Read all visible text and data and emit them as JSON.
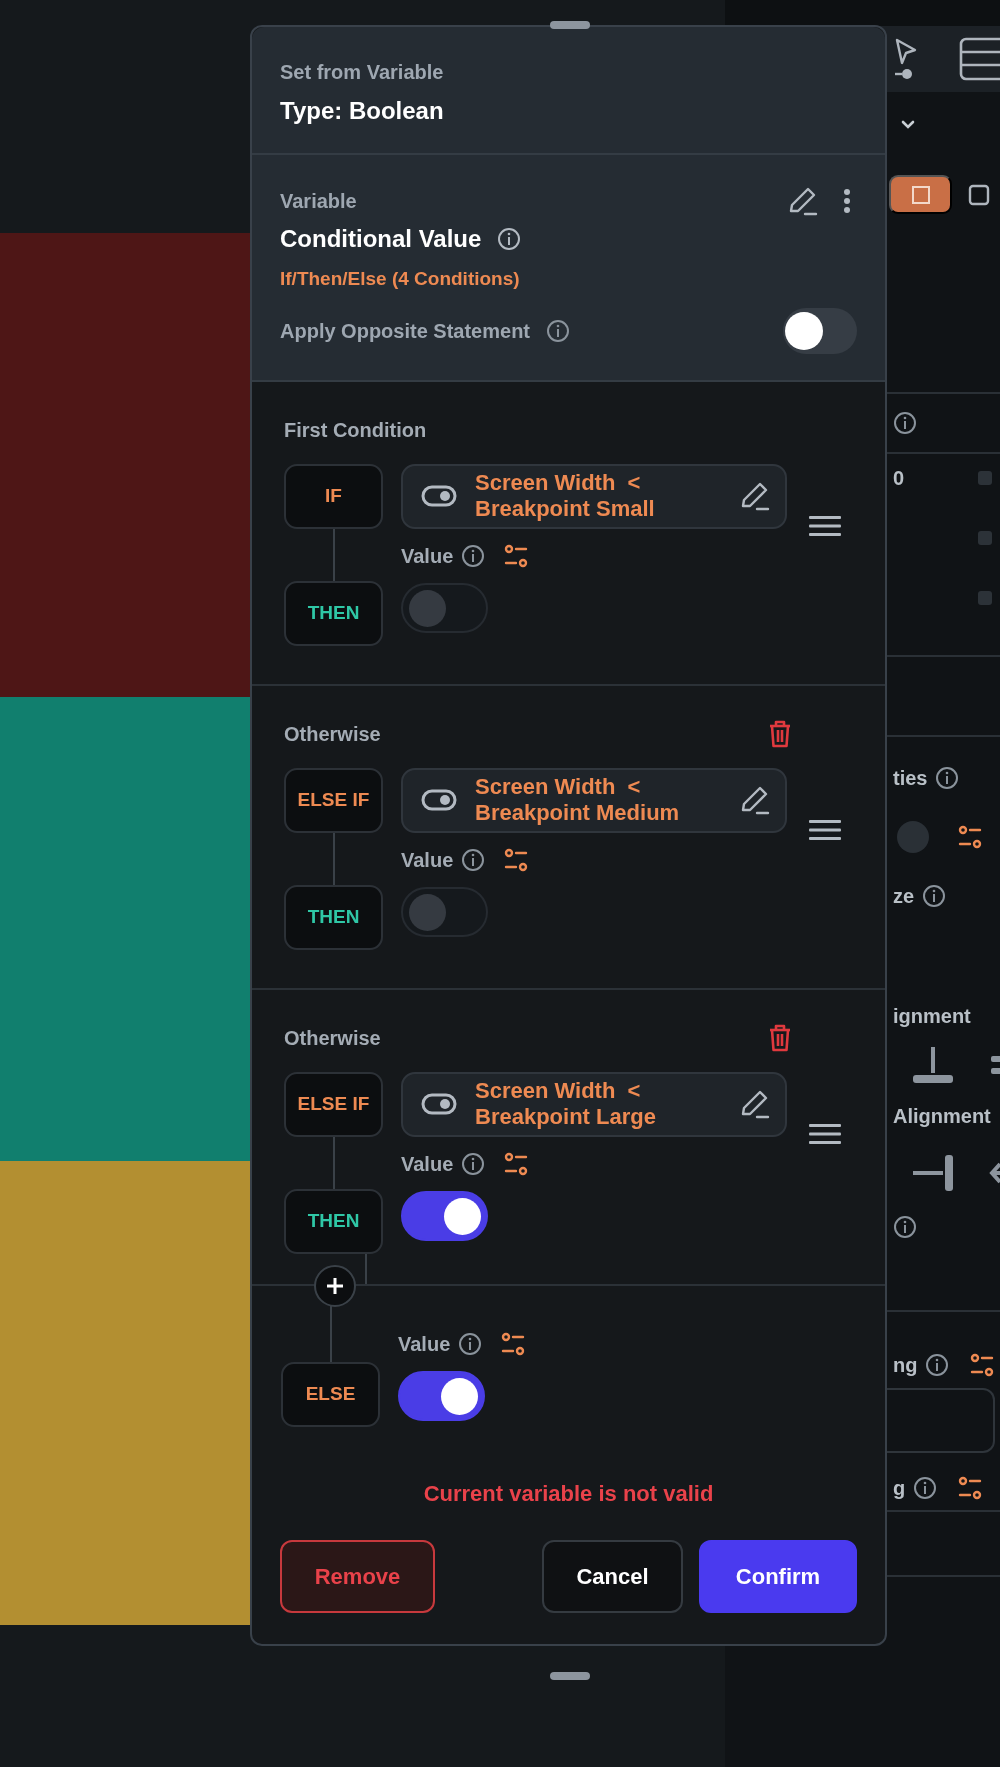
{
  "canvas": {
    "blocks": [
      {
        "color": "#4e1616"
      },
      {
        "color": "#117f6e"
      },
      {
        "color": "#b38f31"
      }
    ]
  },
  "right_panel": {
    "value": "0",
    "labels": [
      "ties",
      "ze",
      "ignment",
      "Alignment",
      "ng",
      "g"
    ]
  },
  "dialog": {
    "subtitle": "Set from Variable",
    "title": "Type: Boolean",
    "variable": {
      "label": "Variable",
      "name": "Conditional Value",
      "summary": "If/Then/Else (4 Conditions)",
      "opposite": {
        "label": "Apply Opposite Statement",
        "on": false
      }
    },
    "conditions": [
      {
        "heading": "First Condition",
        "deletable": false,
        "tag": "IF",
        "expression": [
          "Screen Width  <",
          "Breakpoint Small"
        ],
        "then_tag": "THEN",
        "value_label": "Value",
        "value_on": false
      },
      {
        "heading": "Otherwise",
        "deletable": true,
        "tag": "ELSE IF",
        "expression": [
          "Screen Width  <",
          "Breakpoint Medium"
        ],
        "then_tag": "THEN",
        "value_label": "Value",
        "value_on": false
      },
      {
        "heading": "Otherwise",
        "deletable": true,
        "tag": "ELSE IF",
        "expression": [
          "Screen Width  <",
          "Breakpoint Large"
        ],
        "then_tag": "THEN",
        "value_label": "Value",
        "value_on": true
      }
    ],
    "else": {
      "tag": "ELSE",
      "value_label": "Value",
      "value_on": true
    },
    "error": "Current variable is not valid",
    "buttons": [
      {
        "label": "Remove",
        "kind": "danger"
      },
      {
        "label": "Cancel",
        "kind": "secondary"
      },
      {
        "label": "Confirm",
        "kind": "primary"
      }
    ]
  }
}
